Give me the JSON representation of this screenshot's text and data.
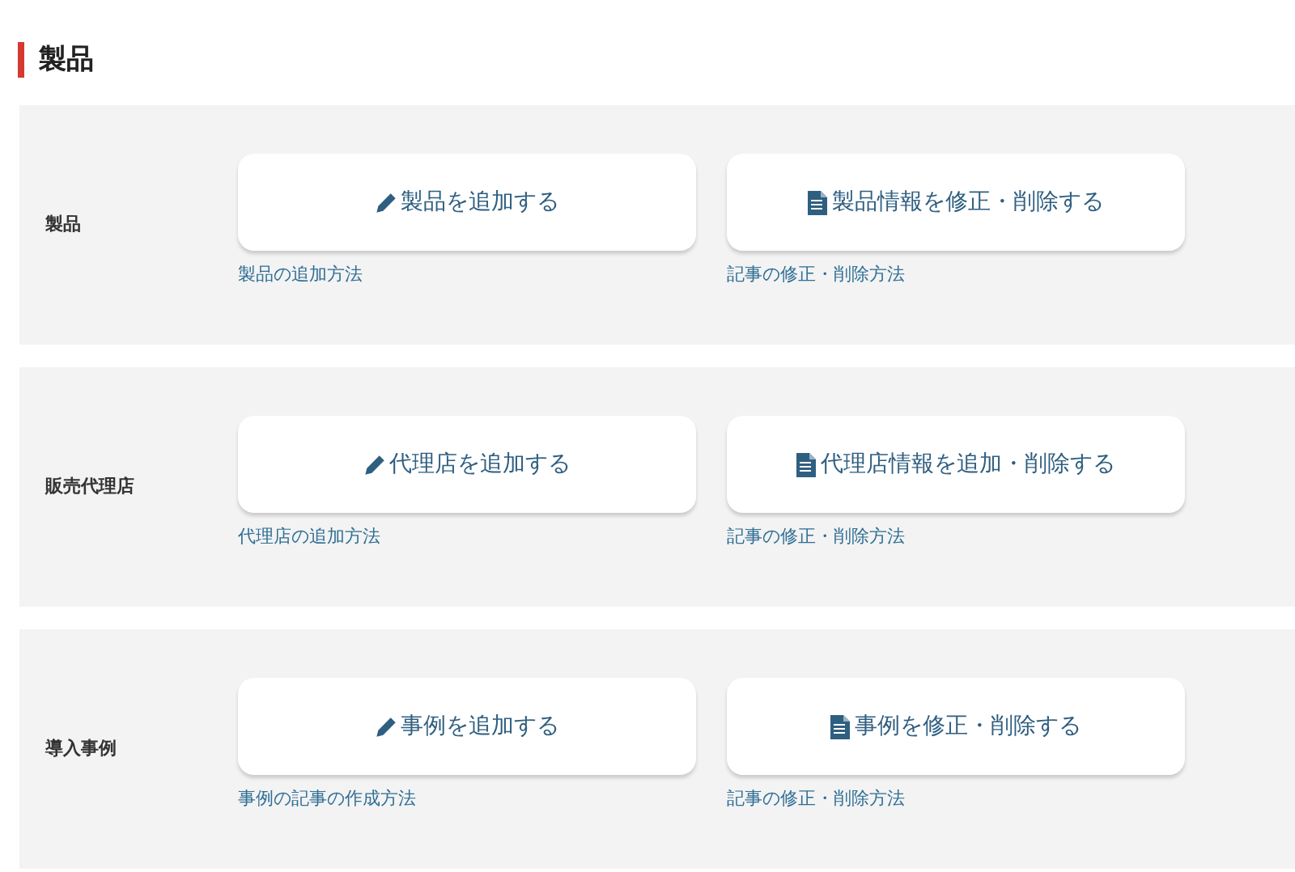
{
  "heading": "製品",
  "sections": [
    {
      "label": "製品",
      "actions": [
        {
          "kind": "add",
          "label": "製品を追加する",
          "help": "製品の追加方法"
        },
        {
          "kind": "edit",
          "label": "製品情報を修正・削除する",
          "help": "記事の修正・削除方法"
        }
      ]
    },
    {
      "label": "販売代理店",
      "actions": [
        {
          "kind": "add",
          "label": "代理店を追加する",
          "help": "代理店の追加方法"
        },
        {
          "kind": "edit",
          "label": "代理店情報を追加・削除する",
          "help": "記事の修正・削除方法"
        }
      ]
    },
    {
      "label": "導入事例",
      "actions": [
        {
          "kind": "add",
          "label": "事例を追加する",
          "help": "事例の記事の作成方法"
        },
        {
          "kind": "edit",
          "label": "事例を修正・削除する",
          "help": "記事の修正・削除方法"
        }
      ]
    }
  ]
}
